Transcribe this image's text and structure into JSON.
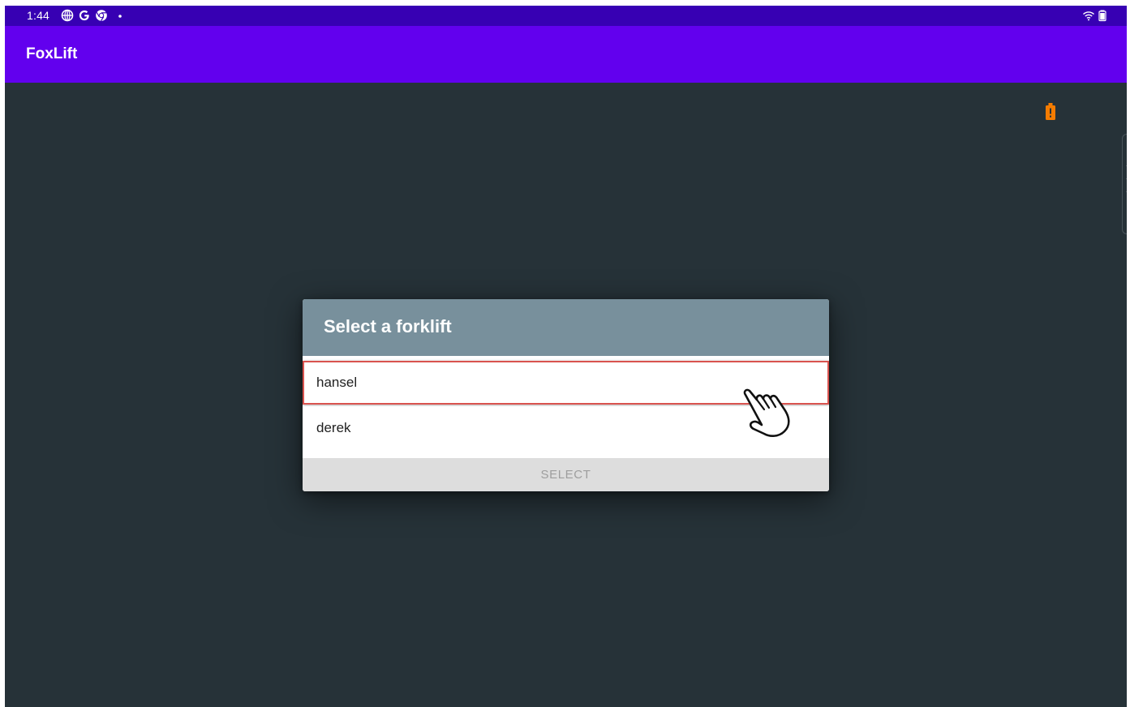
{
  "status_bar": {
    "time": "1:44",
    "icons": [
      "globe-icon",
      "google-icon",
      "chrome-icon",
      "dot-icon",
      "wifi-icon",
      "battery-icon"
    ]
  },
  "app_bar": {
    "title": "FoxLift"
  },
  "indicators": {
    "battery_warning_icon": "battery-alert-icon",
    "battery_warning_color": "#f57c00"
  },
  "dialog": {
    "title": "Select a forklift",
    "items": [
      {
        "label": "hansel",
        "highlighted": true
      },
      {
        "label": "derek",
        "highlighted": false
      }
    ],
    "select_button_label": "SELECT",
    "select_button_enabled": false
  },
  "overlay": {
    "cursor_icon": "hand-pointer-icon"
  },
  "colors": {
    "status_bar": "#3700b3",
    "app_bar": "#6200ee",
    "background": "#263238",
    "dialog_header": "#78909c",
    "highlight_border": "#d9534f"
  }
}
